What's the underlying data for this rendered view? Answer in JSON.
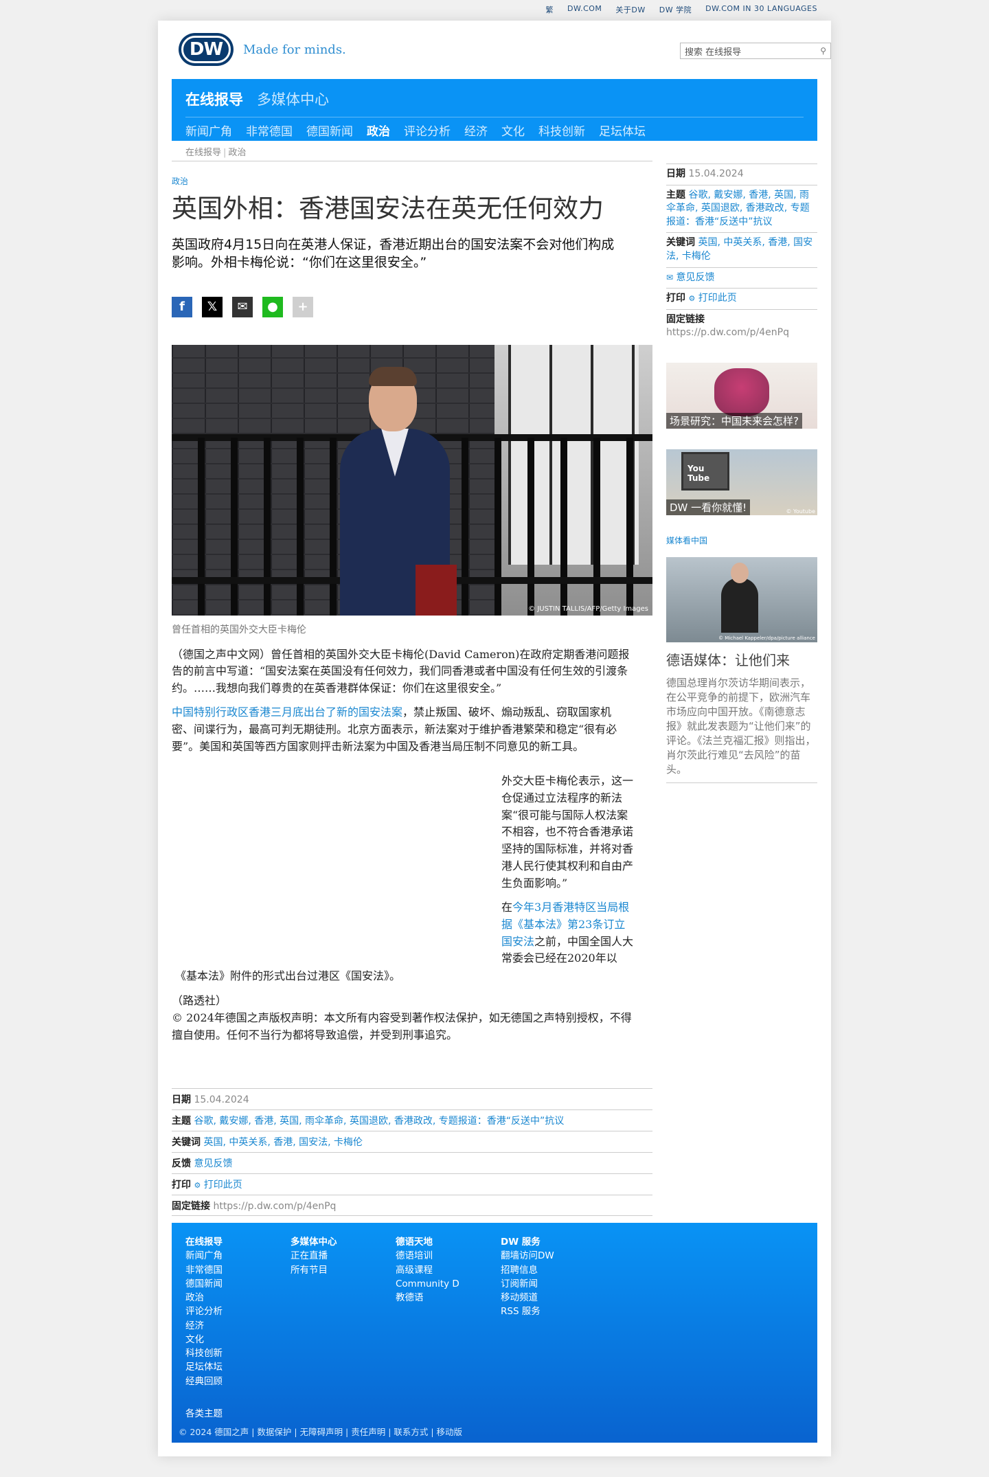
{
  "topstrip": [
    "繁",
    "DW.COM",
    "关于DW",
    "DW 学院",
    "DW.COM IN 30 LANGUAGES"
  ],
  "header": {
    "logo": "DW",
    "tagline": "Made for minds.",
    "search_placeholder": "搜索 在线报导"
  },
  "nav": {
    "main": [
      "在线报导",
      "多媒体中心"
    ],
    "sub": [
      "新闻广角",
      "非常德国",
      "德国新闻",
      "政治",
      "评论分析",
      "经济",
      "文化",
      "科技创新",
      "足坛体坛"
    ],
    "active_sub": "政治"
  },
  "breadcrumb": [
    "在线报导",
    "政治"
  ],
  "article": {
    "kicker": "政治",
    "title": "英国外相：香港国安法在英无任何效力",
    "lead": "英国政府4月15日向在英港人保证，香港近期出台的国安法案不会对他们构成影响。外相卡梅伦说：“你们在这里很安全。”",
    "photo_credit": "© JUSTIN TALLIS/AFP/Getty Images",
    "caption": "曾任首相的英国外交大臣卡梅伦",
    "p1": "（德国之声中文网）曾任首相的英国外交大臣卡梅伦(David Cameron)在政府定期香港问题报告的前言中写道：“国安法案在英国没有任何效力，我们同香港或者中国没有任何生效的引渡条约。……我想向我们尊贵的在英香港群体保证：你们在这里很安全。”",
    "p2_link": "中国特别行政区香港三月底出台了新的国安法案",
    "p2_rest": "，禁止叛国、破坏、煽动叛乱、窃取国家机密、间谍行为，最高可判无期徒刑。北京方面表示，新法案对于维护香港繁荣和稳定“很有必要”。美国和英国等西方国家则抨击新法案为中国及香港当局压制不同意见的新工具。",
    "p3": "外交大臣卡梅伦表示，这一仓促通过立法程序的新法案“很可能与国际人权法案不相容，也不符合香港承诺坚持的国际标准，并将对香港人民行使其权利和自由产生负面影响。”",
    "p4_pre": "在",
    "p4_link": "今年3月香港特区当局根据《基本法》第23条订立国安法",
    "p4_rest": "之前，中国全国人大常委会已经在2020年以",
    "p5": "《基本法》附件的形式出台过港区《国安法》。",
    "p6": "（路透社）",
    "p7": "© 2024年德国之声版权声明：本文所有内容受到著作权法保护，如无德国之声特别授权，不得擅自使用。任何不当行为都将导致追偿，并受到刑事追究。"
  },
  "meta": {
    "date_label": "日期",
    "date": "15.04.2024",
    "topics_label": "主题",
    "topics": "谷歌, 戴安娜, 香港, 英国, 雨伞革命, 英国退欧, 香港政改, 专题报道：香港“反送中”抗议",
    "keywords_label": "关键词",
    "keywords": "英国, 中英关系, 香港, 国安法, 卡梅伦",
    "feedback_label": "反馈",
    "feedback": "意见反馈",
    "print_label": "打印",
    "print": "打印此页",
    "permalink_label": "固定链接",
    "permalink": "https://p.dw.com/p/4enPq"
  },
  "sidebar": {
    "date_label": "日期",
    "date": "15.04.2024",
    "topics_label": "主题",
    "topics": "谷歌, 戴安娜, 香港, 英国, 雨伞革命, 英国退欧, 香港政改, 专题报道：香港“反送中”抗议",
    "keywords_label": "关键词",
    "keywords": "英国, 中英关系, 香港, 国安法, 卡梅伦",
    "feedback": "意见反馈",
    "print_label": "打印",
    "print": "打印此页",
    "permalink_label": "固定链接",
    "permalink": "https://p.dw.com/p/4enPq",
    "promo1": "场景研究：中国未来会怎样?",
    "promo2": "DW 一看你就懂!",
    "promo2_credit": "© Youtube",
    "kicker": "媒体看中国",
    "promo3_credit": "© Michael Kappeler/dpa/picture alliance",
    "headline": "德语媒体：让他们来",
    "para": "德国总理肖尔茨访华期间表示，在公平竞争的前提下，欧洲汽车市场应向中国开放。《南德意志报》就此发表题为“让他们来”的评论。《法兰克福汇报》则指出，肖尔茨此行难见“去风险”的苗头。"
  },
  "footer": {
    "col1": [
      "在线报导",
      "新闻广角",
      "非常德国",
      "德国新闻",
      "政治",
      "评论分析",
      "经济",
      "文化",
      "科技创新",
      "足坛体坛",
      "经典回顾"
    ],
    "col2": [
      "多媒体中心",
      "正在直播",
      "所有节目"
    ],
    "col3": [
      "德语天地",
      "德语培训",
      "高级课程",
      "Community D",
      "教德语"
    ],
    "col4": [
      "DW 服务",
      "翻墙访问DW",
      "招聘信息",
      "订阅新闻",
      "移动频道",
      "RSS 服务"
    ],
    "all_topics": "各类主题",
    "bottom": "© 2024 德国之声 | 数据保护 | 无障碍声明 | 责任声明 | 联系方式 | 移动版"
  }
}
